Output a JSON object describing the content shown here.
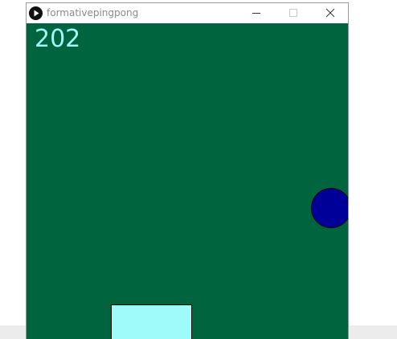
{
  "window": {
    "title": "formativepingpong",
    "icon": "processing-play-icon",
    "controls": [
      "minimize-icon",
      "maximize-icon",
      "close-icon"
    ]
  },
  "game": {
    "score": "202",
    "colors": {
      "background": "#00653e",
      "score_text": "#a4f8f8",
      "ball": "#000099",
      "paddle": "#9ffafa"
    }
  }
}
